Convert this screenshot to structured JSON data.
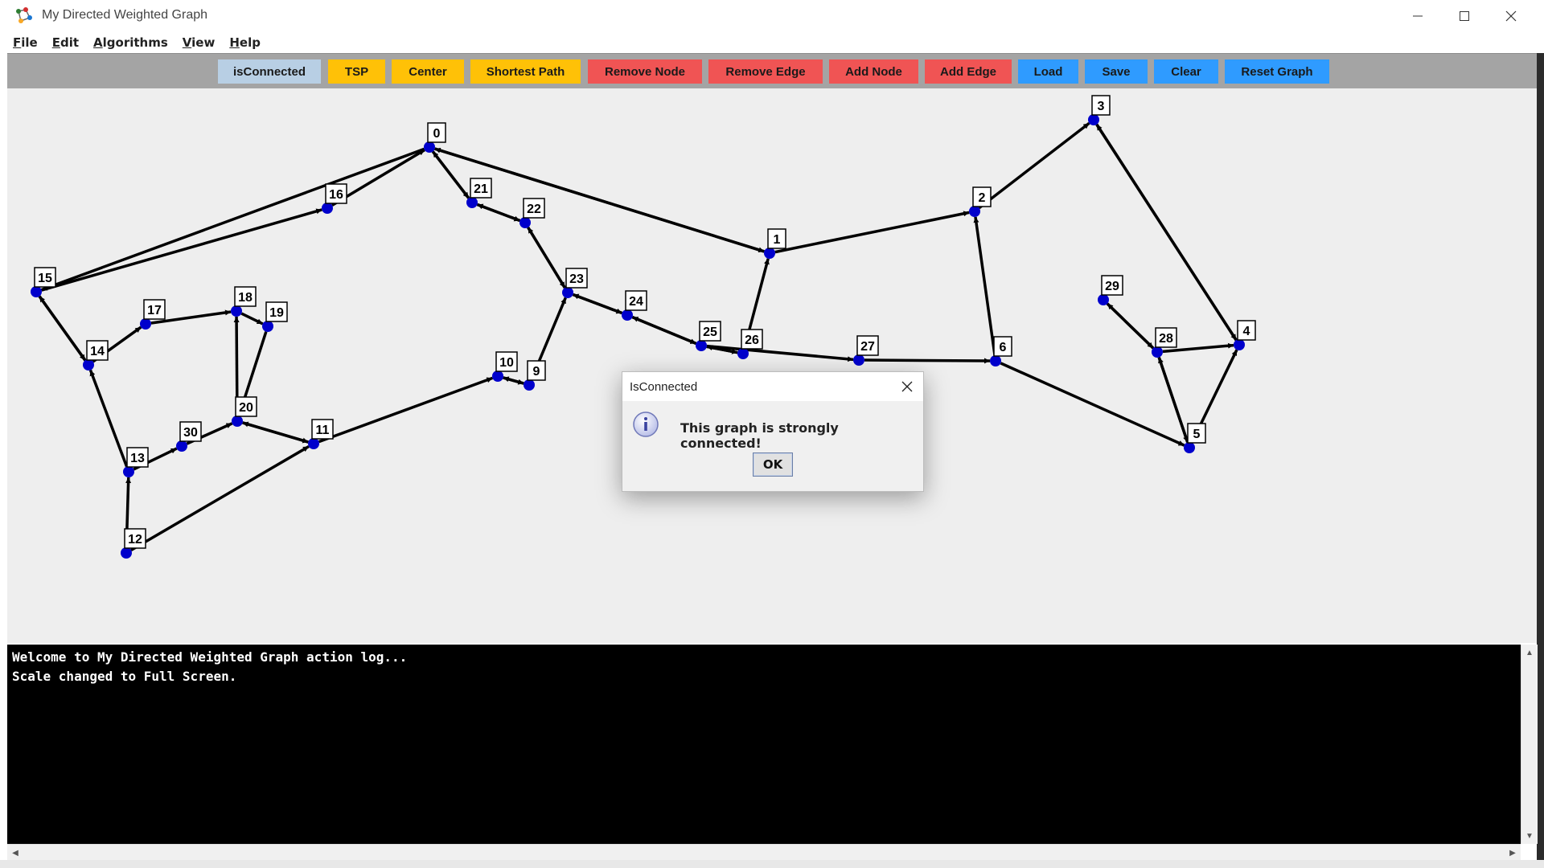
{
  "window": {
    "title": "My Directed Weighted Graph",
    "controls": {
      "minimize": "—",
      "maximize": "☐",
      "close": "✕"
    }
  },
  "menu": [
    {
      "underline": "F",
      "rest": "ile"
    },
    {
      "underline": "E",
      "rest": "dit"
    },
    {
      "underline": "A",
      "rest": "lgorithms"
    },
    {
      "underline": "V",
      "rest": "iew"
    },
    {
      "underline": "H",
      "rest": "elp"
    }
  ],
  "toolbar": [
    {
      "name": "isconnected-button",
      "label": "isConnected",
      "color": "#b8cfe4"
    },
    {
      "name": "tsp-button",
      "label": "TSP",
      "color": "#ffc107"
    },
    {
      "name": "center-button",
      "label": "Center",
      "color": "#ffc107"
    },
    {
      "name": "shortest-path-button",
      "label": "Shortest Path",
      "color": "#ffc107"
    },
    {
      "name": "remove-node-button",
      "label": "Remove Node",
      "color": "#f05454"
    },
    {
      "name": "remove-edge-button",
      "label": "Remove Edge",
      "color": "#f05454"
    },
    {
      "name": "add-node-button",
      "label": "Add Node",
      "color": "#f05454"
    },
    {
      "name": "add-edge-button",
      "label": "Add Edge",
      "color": "#f05454"
    },
    {
      "name": "load-button",
      "label": "Load",
      "color": "#2f9bff"
    },
    {
      "name": "save-button",
      "label": "Save",
      "color": "#2f9bff"
    },
    {
      "name": "clear-button",
      "label": "Clear",
      "color": "#2f9bff"
    },
    {
      "name": "reset-graph-button",
      "label": "Reset Graph",
      "color": "#2f9bff"
    }
  ],
  "graph": {
    "node_color": "#0000cc",
    "edge_color": "#000000",
    "nodes": [
      {
        "id": "0"
      },
      {
        "id": "1"
      },
      {
        "id": "2"
      },
      {
        "id": "3"
      },
      {
        "id": "4"
      },
      {
        "id": "5"
      },
      {
        "id": "6"
      },
      {
        "id": "9"
      },
      {
        "id": "10"
      },
      {
        "id": "11"
      },
      {
        "id": "12"
      },
      {
        "id": "13"
      },
      {
        "id": "14"
      },
      {
        "id": "15"
      },
      {
        "id": "16"
      },
      {
        "id": "17"
      },
      {
        "id": "18"
      },
      {
        "id": "19"
      },
      {
        "id": "20"
      },
      {
        "id": "21"
      },
      {
        "id": "22"
      },
      {
        "id": "23"
      },
      {
        "id": "24"
      },
      {
        "id": "25"
      },
      {
        "id": "26"
      },
      {
        "id": "27"
      },
      {
        "id": "28"
      },
      {
        "id": "29"
      },
      {
        "id": "30"
      }
    ],
    "edges": [
      [
        "15",
        "16"
      ],
      [
        "16",
        "0"
      ],
      [
        "0",
        "15"
      ],
      [
        "0",
        "1"
      ],
      [
        "1",
        "0"
      ],
      [
        "0",
        "21"
      ],
      [
        "21",
        "0"
      ],
      [
        "21",
        "22"
      ],
      [
        "22",
        "21"
      ],
      [
        "22",
        "23"
      ],
      [
        "23",
        "22"
      ],
      [
        "23",
        "24"
      ],
      [
        "24",
        "23"
      ],
      [
        "24",
        "25"
      ],
      [
        "25",
        "24"
      ],
      [
        "25",
        "26"
      ],
      [
        "26",
        "25"
      ],
      [
        "26",
        "1"
      ],
      [
        "1",
        "2"
      ],
      [
        "2",
        "3"
      ],
      [
        "3",
        "4"
      ],
      [
        "4",
        "3"
      ],
      [
        "6",
        "2"
      ],
      [
        "6",
        "5"
      ],
      [
        "5",
        "4"
      ],
      [
        "5",
        "28"
      ],
      [
        "28",
        "5"
      ],
      [
        "28",
        "4"
      ],
      [
        "28",
        "29"
      ],
      [
        "29",
        "28"
      ],
      [
        "10",
        "9"
      ],
      [
        "9",
        "23"
      ],
      [
        "9",
        "10"
      ],
      [
        "11",
        "10"
      ],
      [
        "12",
        "11"
      ],
      [
        "12",
        "13"
      ],
      [
        "13",
        "14"
      ],
      [
        "14",
        "15"
      ],
      [
        "15",
        "14"
      ],
      [
        "14",
        "17"
      ],
      [
        "17",
        "18"
      ],
      [
        "18",
        "19"
      ],
      [
        "19",
        "20"
      ],
      [
        "20",
        "18"
      ],
      [
        "13",
        "30"
      ],
      [
        "30",
        "20"
      ],
      [
        "20",
        "11"
      ],
      [
        "11",
        "20"
      ],
      [
        "27",
        "6"
      ],
      [
        "25",
        "27"
      ]
    ]
  },
  "log": {
    "lines": [
      "Welcome to My Directed Weighted Graph action log...",
      "Scale changed to Full Screen."
    ]
  },
  "dialog": {
    "title": "IsConnected",
    "message": "This graph is strongly connected!",
    "ok_label": "OK"
  }
}
